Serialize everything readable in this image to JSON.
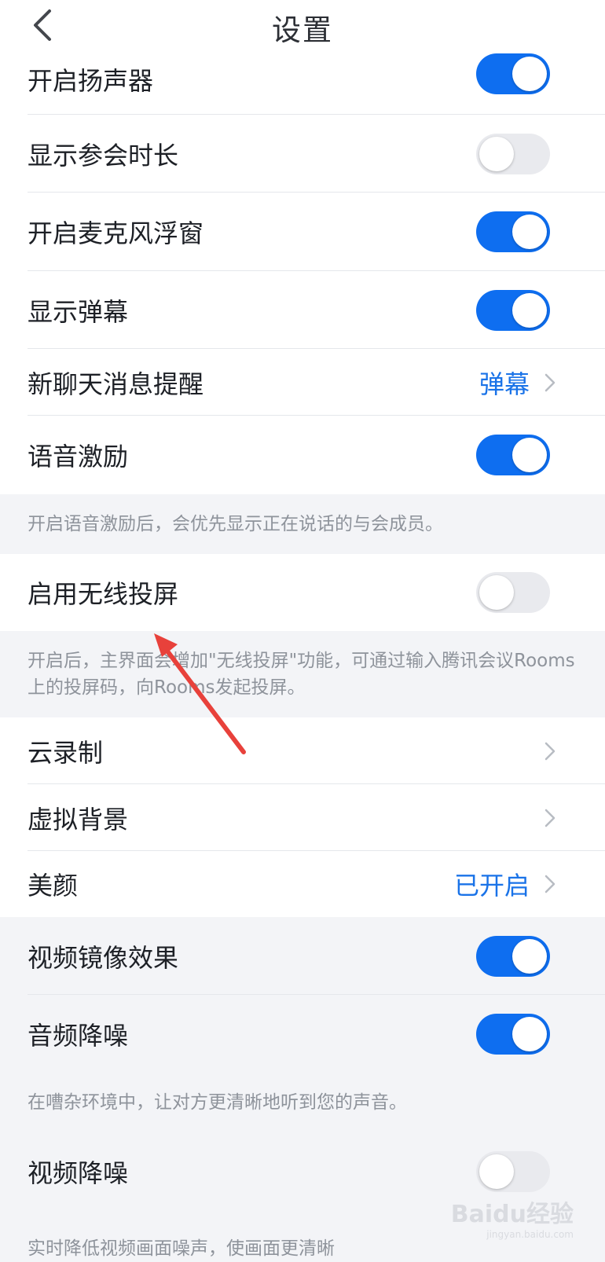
{
  "header": {
    "title": "设置"
  },
  "rows": {
    "speaker": {
      "label": "开启扬声器",
      "on": true
    },
    "duration": {
      "label": "显示参会时长",
      "on": false
    },
    "mic_float": {
      "label": "开启麦克风浮窗",
      "on": true
    },
    "danmu": {
      "label": "显示弹幕",
      "on": true
    },
    "new_msg": {
      "label": "新聊天消息提醒",
      "value": "弹幕"
    },
    "voice_excite": {
      "label": "语音激励",
      "on": true
    },
    "wireless": {
      "label": "启用无线投屏",
      "on": false
    },
    "cloud_rec": {
      "label": "云录制"
    },
    "virtual_bg": {
      "label": "虚拟背景"
    },
    "beauty": {
      "label": "美颜",
      "value": "已开启"
    },
    "mirror": {
      "label": "视频镜像效果",
      "on": true
    },
    "audio_denoise": {
      "label": "音频降噪",
      "on": true
    },
    "video_denoise": {
      "label": "视频降噪",
      "on": false
    }
  },
  "notes": {
    "voice_excite": "开启语音激励后，会优先显示正在说话的与会成员。",
    "wireless": "开启后，主界面会增加\"无线投屏\"功能，可通过输入腾讯会议Rooms上的投屏码，向Rooms发起投屏。",
    "audio_denoise": "在嘈杂环境中，让对方更清晰地听到您的声音。",
    "video_denoise": "实时降低视频画面噪声，使画面更清晰"
  },
  "watermark": {
    "brand": "Baidu经验",
    "url": "jingyan.baidu.com"
  },
  "colors": {
    "accent": "#0e6ef0",
    "annotation_arrow": "#e8413b"
  }
}
